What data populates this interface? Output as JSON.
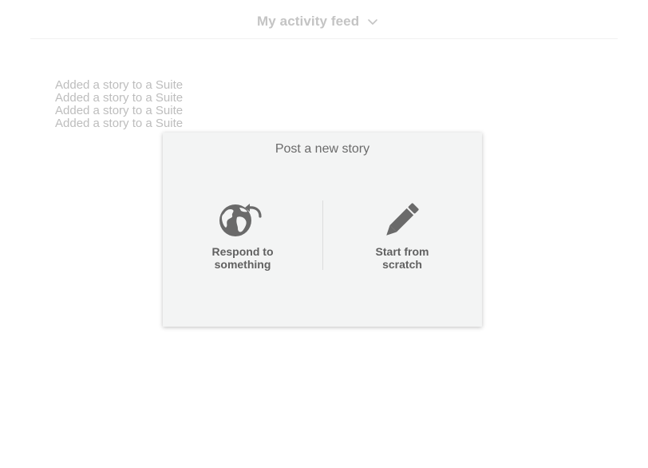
{
  "header": {
    "feed_title": "My activity feed",
    "dropdown_icon": "chevron-down-icon"
  },
  "activity": {
    "items": [
      "Added a story to a Suite",
      "Added a story to a Suite",
      "Added a story to a Suite",
      "Added a story to a Suite"
    ]
  },
  "modal": {
    "title": "Post a new story",
    "options": [
      {
        "label": "Respond to something",
        "icon": "globe-reply-icon"
      },
      {
        "label": "Start from scratch",
        "icon": "pencil-icon"
      }
    ]
  },
  "colors": {
    "muted_text": "#bdbdbd",
    "modal_background": "#f3f4f4",
    "icon": "#6a6a6a"
  }
}
